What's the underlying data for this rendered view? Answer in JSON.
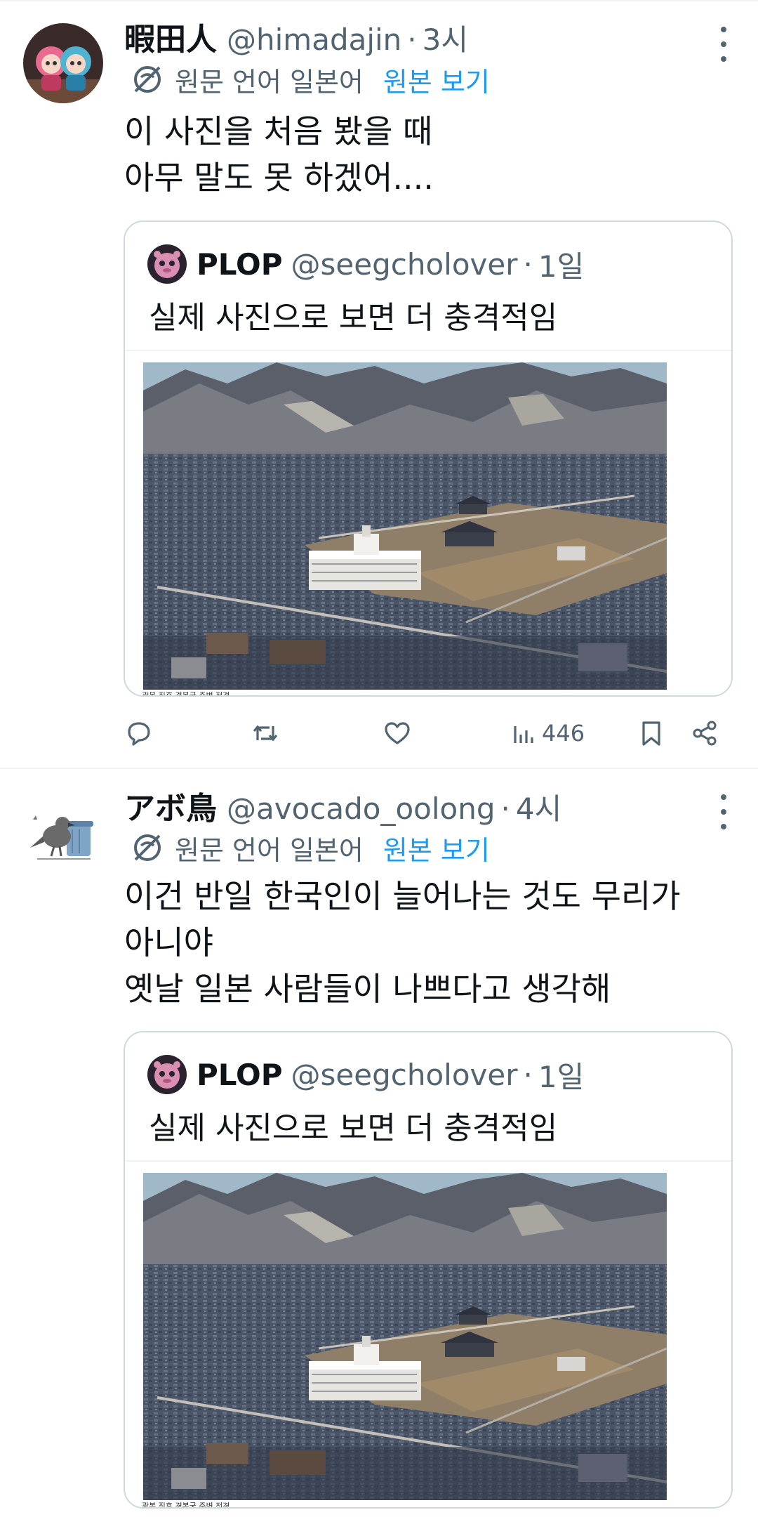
{
  "posts": [
    {
      "display_name": "暇田人",
      "handle": "@himadajin",
      "separator": "·",
      "time": "3시",
      "translated_from": "원문 언어 일본어",
      "show_original": "원본 보기",
      "text_lines": [
        "이 사진을 처음 봤을 때",
        "아무 말도 못 하겠어...."
      ],
      "quote": {
        "display_name": "PLOP",
        "handle": "@seegcholover",
        "separator": "·",
        "time": "1일",
        "text": "실제 사진으로 보면 더 충격적임",
        "photo_caption": "광복 직후 경복궁 주변 전경."
      },
      "views": "446",
      "icons": [
        "translate-icon",
        "more-icon",
        "reply-icon",
        "repost-icon",
        "like-icon",
        "views-icon",
        "bookmark-icon",
        "share-icon"
      ]
    },
    {
      "display_name": "アボ鳥",
      "handle": "@avocado_oolong",
      "separator": "·",
      "time": "4시",
      "translated_from": "원문 언어 일본어",
      "show_original": "원본 보기",
      "text_lines": [
        "이건 반일 한국인이 늘어나는 것도 무리가",
        "아니야",
        "옛날 일본 사람들이 나쁘다고 생각해"
      ],
      "quote": {
        "display_name": "PLOP",
        "handle": "@seegcholover",
        "separator": "·",
        "time": "1일",
        "text": "실제 사진으로 보면 더 충격적임",
        "photo_caption": "광복 직후 경복궁 주변 전경."
      }
    }
  ],
  "colors": {
    "text_primary": "#0f1419",
    "text_secondary": "#536471",
    "link_blue": "#1d9bf0",
    "border": "#cfd9de"
  }
}
